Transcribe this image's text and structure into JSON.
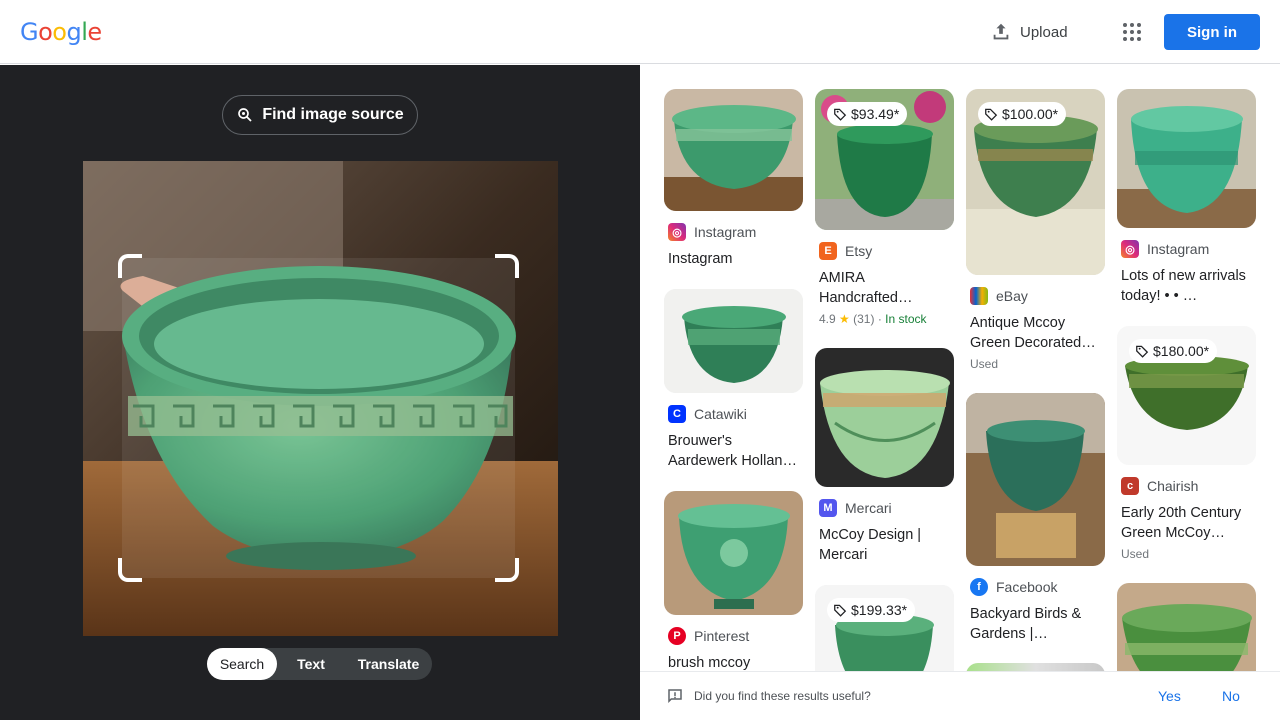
{
  "header": {
    "logo_letters": [
      "G",
      "o",
      "o",
      "g",
      "l",
      "e"
    ],
    "logo_colors": [
      "#4285f4",
      "#ea4335",
      "#fbbc05",
      "#4285f4",
      "#34a853",
      "#ea4335"
    ],
    "upload_label": "Upload",
    "signin_label": "Sign in"
  },
  "lens": {
    "find_source_label": "Find image source",
    "modes": [
      "Search",
      "Text",
      "Translate"
    ],
    "active_mode": "Search"
  },
  "results": [
    {
      "source": "Instagram",
      "favicon": "instagram-icon",
      "title": "Instagram"
    },
    {
      "source": "Catawiki",
      "favicon": "catawiki-icon",
      "title": "Brouwer's Aardewerk Hollan…"
    },
    {
      "source": "Pinterest",
      "favicon": "pinterest-icon",
      "title": "brush mccoy"
    },
    {
      "price": "$93.49*",
      "source": "Etsy",
      "favicon": "etsy-icon",
      "title": "AMIRA Handcrafted…",
      "rating": "4.9",
      "reviews": "(31)",
      "stock": "In stock"
    },
    {
      "source": "Mercari",
      "favicon": "mercari-icon",
      "title": "McCoy Design | Mercari"
    },
    {
      "price": "$199.33*"
    },
    {
      "price": "$100.00*",
      "source": "eBay",
      "favicon": "ebay-icon",
      "title": "Antique Mccoy Green Decorated…",
      "condition": "Used"
    },
    {
      "source": "Facebook",
      "favicon": "facebook-icon",
      "title": "Backyard Birds & Gardens |…"
    },
    {
      "source": "Instagram",
      "favicon": "instagram-icon",
      "title": "Lots of new arrivals today! • • …"
    },
    {
      "price": "$180.00*",
      "source": "Chairish",
      "favicon": "chairish-icon",
      "title": "Early 20th Century Green McCoy…",
      "condition": "Used"
    }
  ],
  "feedback": {
    "question": "Did you find these results useful?",
    "yes": "Yes",
    "no": "No"
  },
  "colors": {
    "accent": "#1a73e8",
    "panel_dark": "#202124",
    "pot_green": "#3f9a6a"
  }
}
